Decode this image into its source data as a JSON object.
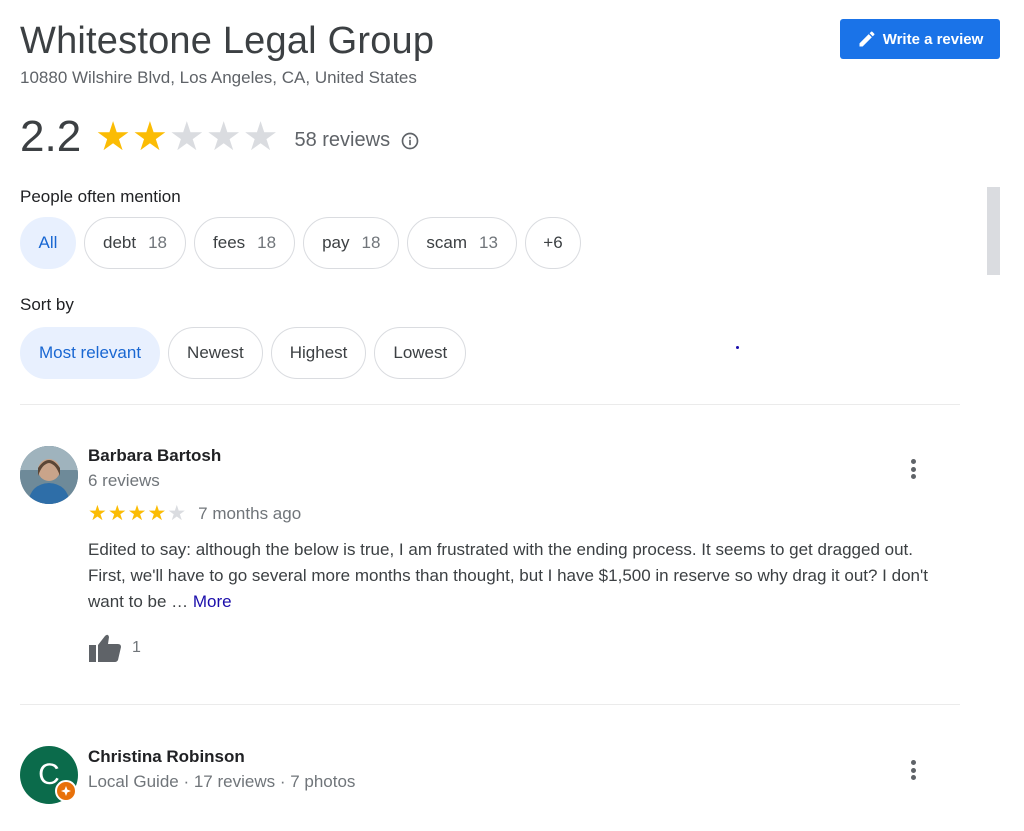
{
  "place": {
    "title": "Whitestone Legal Group",
    "address": "10880 Wilshire Blvd, Los Angeles, CA, United States",
    "write_review_label": "Write a review",
    "write_review_icon": "pencil-icon",
    "accent_color": "#1a73e8",
    "star_color": "#fbbc04"
  },
  "summary": {
    "rating": "2.2",
    "stars_filled": 2,
    "stars_total": 5,
    "reviews_label": "58 reviews",
    "info_icon": "info-icon"
  },
  "mentions": {
    "label": "People often mention",
    "chips": [
      {
        "label": "All",
        "count": "",
        "active": true
      },
      {
        "label": "debt",
        "count": "18"
      },
      {
        "label": "fees",
        "count": "18"
      },
      {
        "label": "pay",
        "count": "18"
      },
      {
        "label": "scam",
        "count": "13"
      },
      {
        "label": "+6",
        "count": ""
      }
    ]
  },
  "sort": {
    "label": "Sort by",
    "options": [
      {
        "label": "Most relevant",
        "active": true
      },
      {
        "label": "Newest"
      },
      {
        "label": "Highest"
      },
      {
        "label": "Lowest"
      }
    ]
  },
  "reviews": [
    {
      "name": "Barbara Bartosh",
      "meta": "6 reviews",
      "stars_filled": 4,
      "date": "7 months ago",
      "text": "Edited to say: although the below is true, I am frustrated with the ending process. It seems to get dragged out. First, we'll have to go several more months than thought, but I have $1,500 in reserve so why drag it out? I don't want to be … ",
      "more_label": "More",
      "likes": "1"
    },
    {
      "name": "Christina Robinson",
      "meta": "Local Guide · 17 reviews · 7 photos",
      "avatar_letter": "C"
    }
  ]
}
